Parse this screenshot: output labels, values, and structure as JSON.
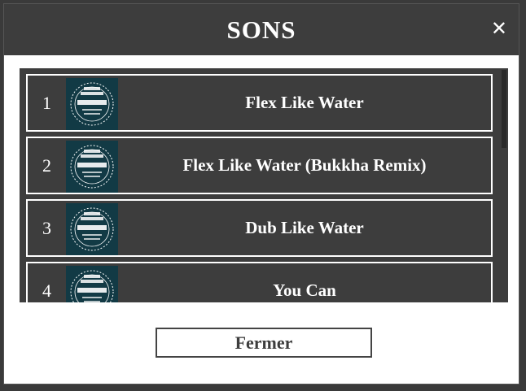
{
  "modal": {
    "title": "SONS",
    "close_label": "✕",
    "close_button_label": "Fermer"
  },
  "tracks": [
    {
      "number": "1",
      "title": "Flex Like Water",
      "cover_icon": "album-cover-icon"
    },
    {
      "number": "2",
      "title": "Flex Like Water (Bukkha Remix)",
      "cover_icon": "album-cover-icon"
    },
    {
      "number": "3",
      "title": "Dub Like Water",
      "cover_icon": "album-cover-icon"
    },
    {
      "number": "4",
      "title": "You Can",
      "cover_icon": "album-cover-icon"
    }
  ],
  "colors": {
    "header_bg": "#3d3d3d",
    "list_bg": "#3d3d3d",
    "cover_bg": "#123a45",
    "text": "#ffffff"
  }
}
